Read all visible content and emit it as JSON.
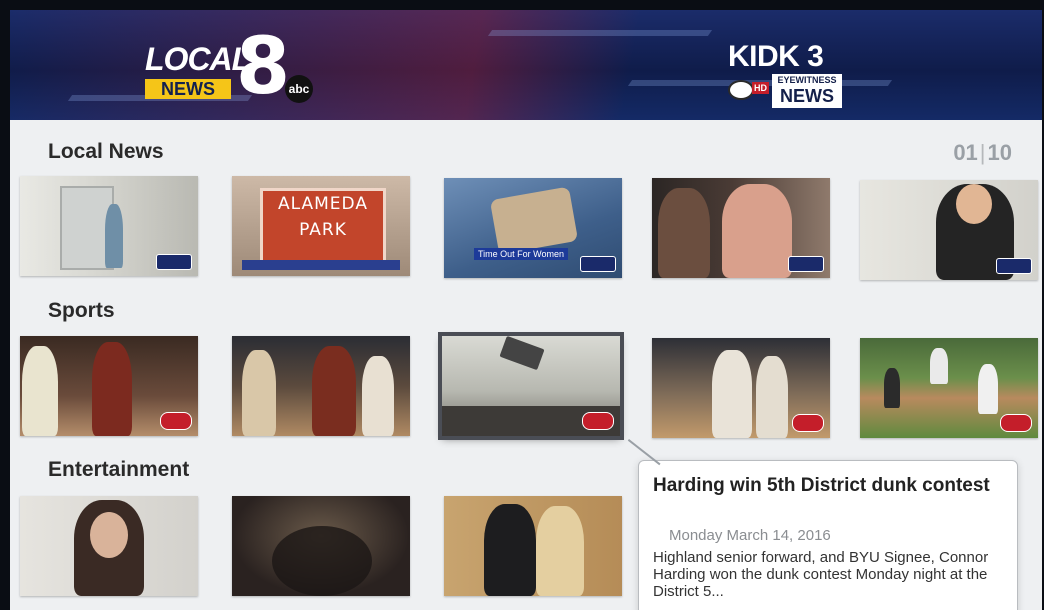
{
  "header": {
    "local_logo": {
      "word": "LOCAL",
      "news": "NEWS",
      "numeral": "8",
      "network": "abc"
    },
    "kidk_logo": {
      "word": "KIDK 3",
      "hd": "HD",
      "eyewitness": "EYEWITNESS",
      "news": "NEWS"
    }
  },
  "pager": {
    "current": "01",
    "total": "10"
  },
  "sections": [
    {
      "title": "Local News"
    },
    {
      "title": "Sports"
    },
    {
      "title": "Entertainment"
    }
  ],
  "thumb_text": {
    "alameda_line1": "ALAMEDA",
    "alameda_line2": "PARK",
    "cake_caption": "Time Out For Women"
  },
  "selected_item": {
    "title": "Harding win 5th District dunk contest",
    "date": "Monday March 14, 2016",
    "description": "Highland senior forward, and BYU Signee, Connor Harding won the dunk contest Monday night at the District 5..."
  },
  "colors": {
    "accent_red": "#c41e2a",
    "brand_blue": "#1a2a6a",
    "highlight": "#4a4d55"
  }
}
